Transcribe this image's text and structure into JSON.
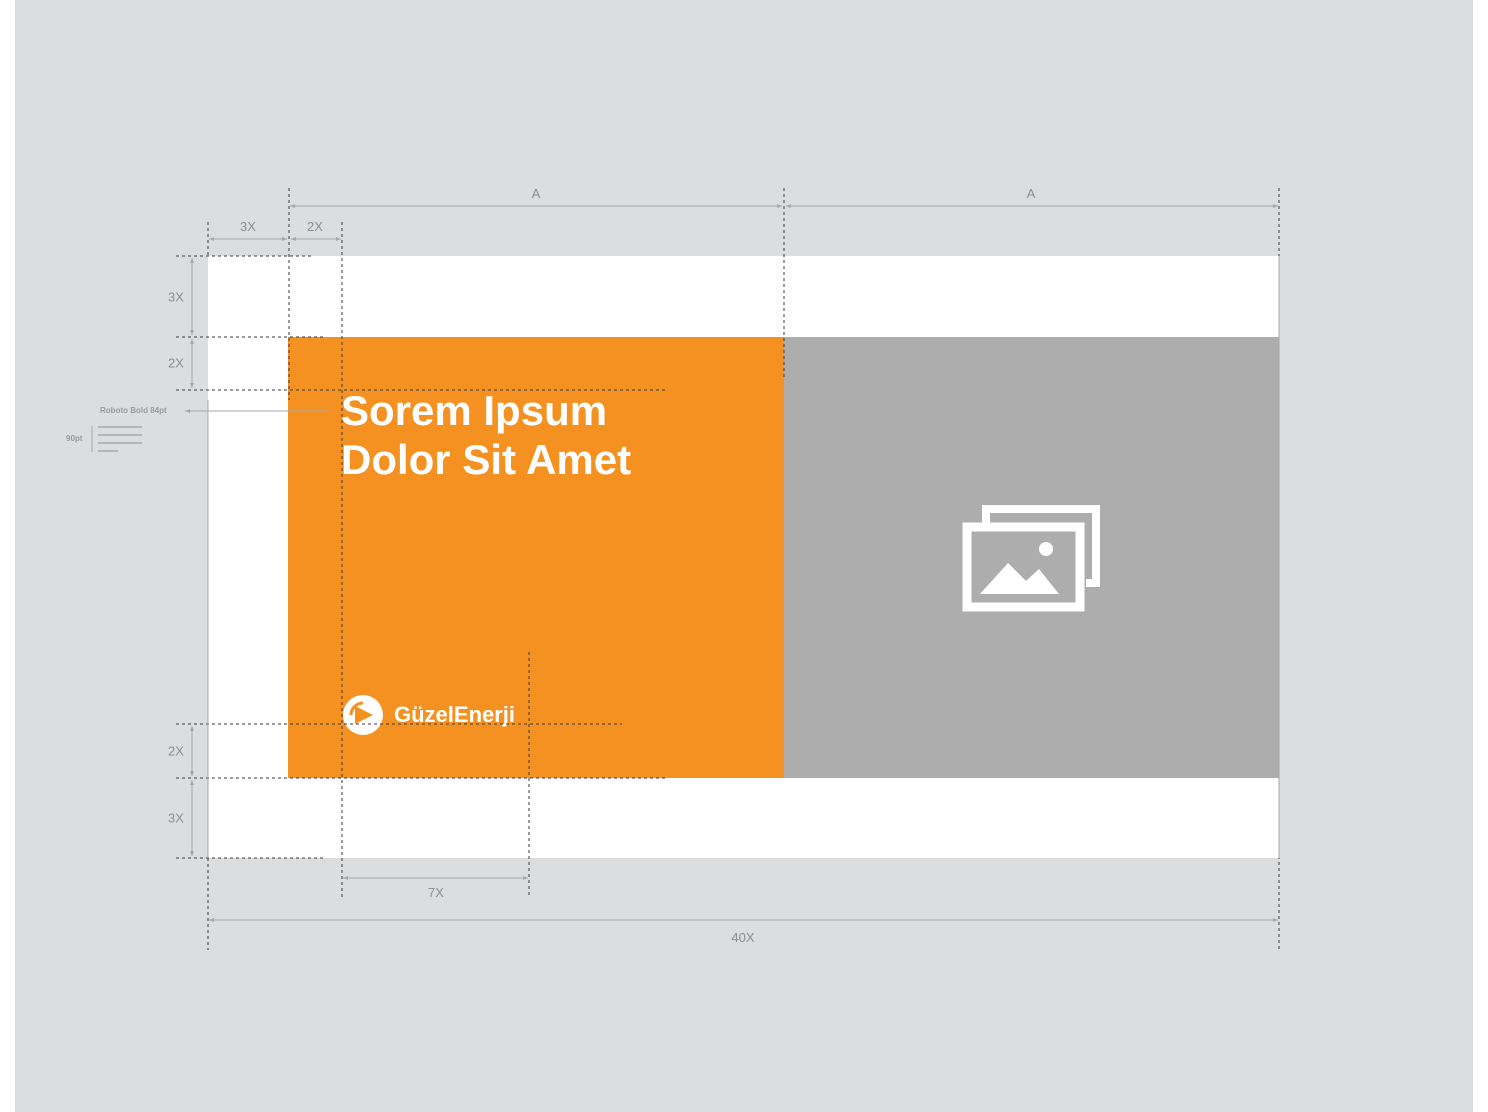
{
  "headline": {
    "line1": "Sorem Ipsum",
    "line2": "Dolor Sit Amet"
  },
  "logo": {
    "text": "GüzelEnerji"
  },
  "icons": {
    "image_placeholder": "image-placeholder-icon",
    "logo": "logo-mark-icon",
    "text_lines": "text-lines-icon"
  },
  "dimensions": {
    "top_a_left": "A",
    "top_a_right": "A",
    "margin_left_3x": "3X",
    "margin_left_2x": "2X",
    "margin_top_3x": "3X",
    "margin_top_2x": "2X",
    "margin_bottom_2x": "2X",
    "margin_bottom_3x": "3X",
    "logo_width_7x": "7X",
    "total_width": "40X"
  },
  "typography": {
    "font_note": "Roboto Bold 84pt",
    "leading_note": "90pt"
  },
  "colors": {
    "background": "#dcdddf",
    "canvas": "#ffffff",
    "accent_orange": "#f59121",
    "image_panel": "#adadad",
    "guide": "#8e8e8e"
  }
}
